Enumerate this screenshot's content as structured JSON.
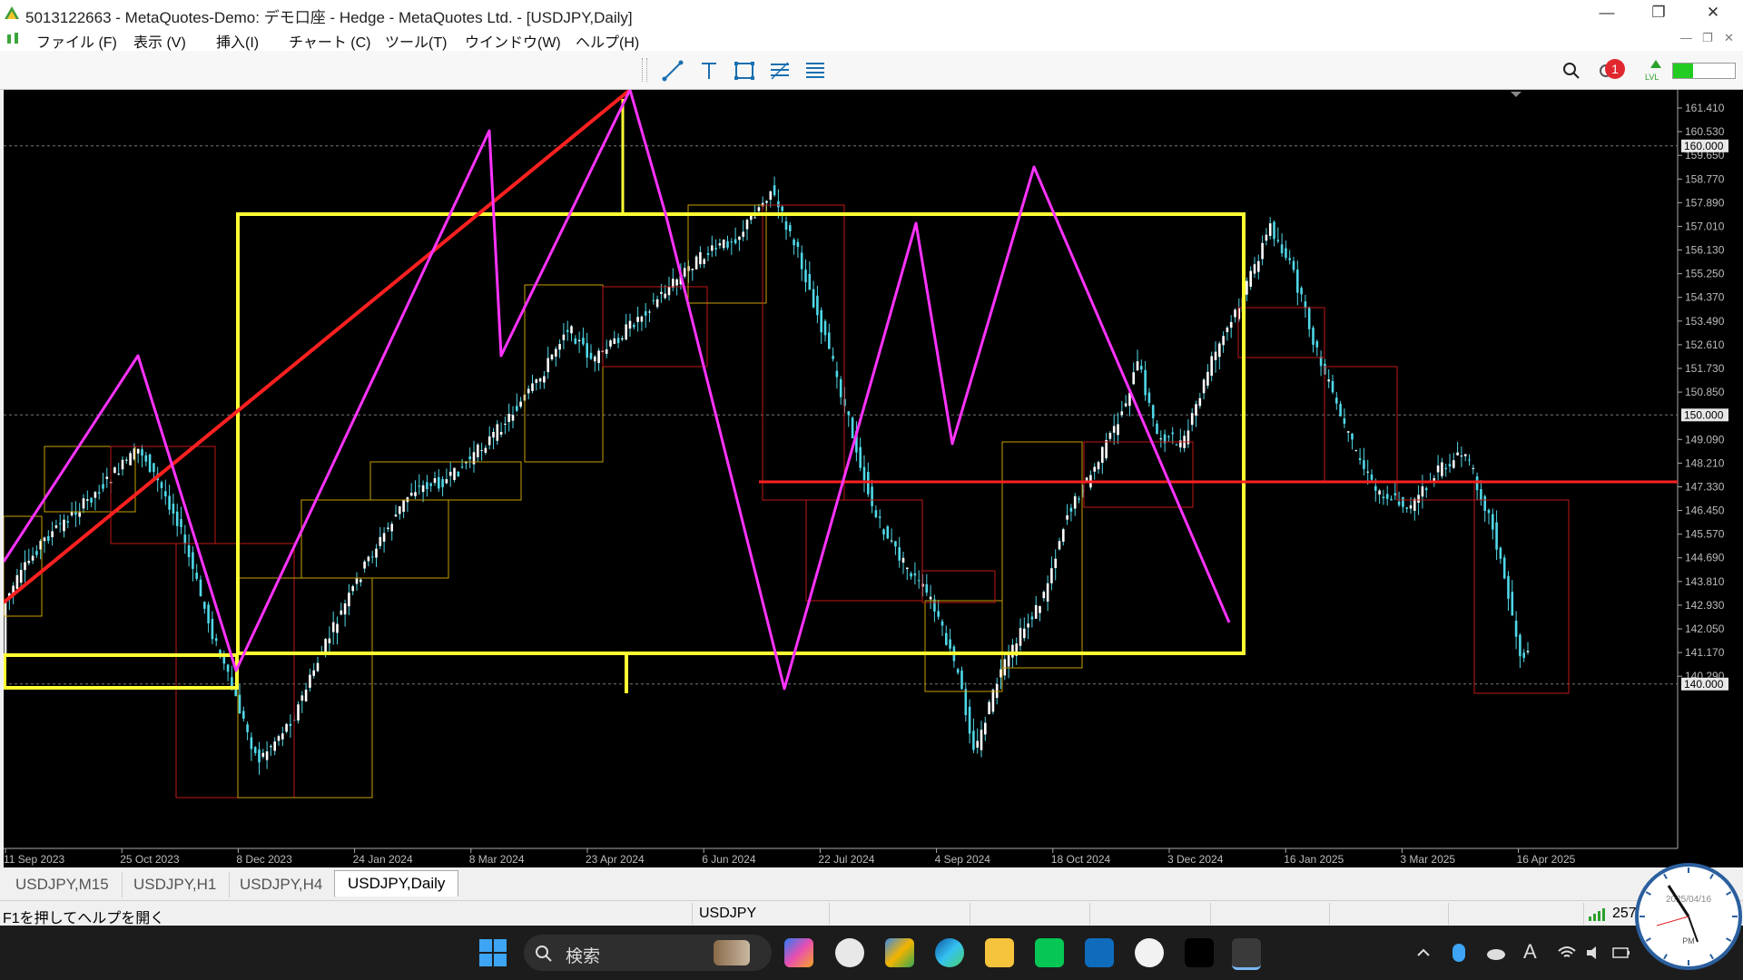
{
  "window": {
    "title": "5013122663 - MetaQuotes-Demo: デモ口座 - Hedge - MetaQuotes Ltd. - [USDJPY,Daily]",
    "minimize": "—",
    "restore": "❐",
    "close": "✕"
  },
  "menu": {
    "items": [
      "ファイル (F)",
      "表示 (V)",
      "挿入(I)",
      "チャート (C)",
      "ツール(T)",
      "ウインドウ(W)",
      "ヘルプ(H)"
    ],
    "mdi": [
      "—",
      "❐",
      "✕"
    ]
  },
  "toolbar": {
    "icons": [
      "trendline-icon",
      "text-icon",
      "rectangle-icon",
      "fibonacci-icon",
      "channel-icon"
    ],
    "notification_count": "1",
    "lvl_label": "LVL"
  },
  "chart": {
    "symbol": "USDJPY",
    "timeframe": "Daily",
    "background": "#000000",
    "candle_color": "#4fd8e8",
    "zigzag_color": "#ff33ff",
    "trend_color": "#ff2020",
    "box_yellow": "#ffff33",
    "price_labels": [
      "161.410",
      "160.530",
      "159.650",
      "158.770",
      "157.890",
      "157.010",
      "156.130",
      "155.250",
      "154.370",
      "153.490",
      "152.610",
      "151.730",
      "150.850",
      "149.090",
      "148.210",
      "147.330",
      "146.450",
      "145.570",
      "144.690",
      "143.810",
      "142.930",
      "142.050",
      "141.170",
      "140.290"
    ],
    "highlight_labels": [
      "160.000",
      "150.000",
      "140.000"
    ],
    "date_labels": [
      "11 Sep 2023",
      "25 Oct 2023",
      "8 Dec 2023",
      "24 Jan 2024",
      "8 Mar 2024",
      "23 Apr 2024",
      "6 Jun 2024",
      "22 Jul 2024",
      "4 Sep 2024",
      "18 Oct 2024",
      "3 Dec 2024",
      "16 Jan 2025",
      "3 Mar 2025",
      "16 Apr 2025"
    ]
  },
  "tabs": [
    "USDJPY,M15",
    "USDJPY,H1",
    "USDJPY,H4",
    "USDJPY,Daily"
  ],
  "active_tab": "USDJPY,Daily",
  "status": {
    "help": "F1を押してヘルプを開く",
    "symbol": "USDJPY",
    "connection": "257"
  },
  "taskbar": {
    "search_placeholder": "検索",
    "clock_date": "2025/04/16",
    "clock_ampm": "PM"
  }
}
